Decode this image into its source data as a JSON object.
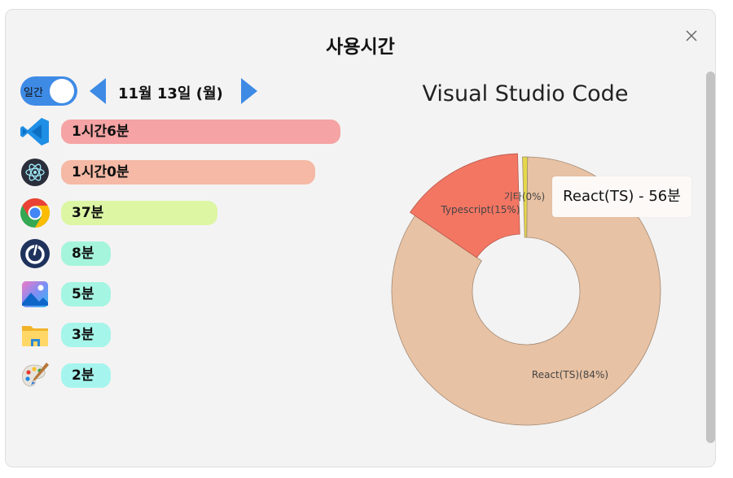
{
  "title": "사용시간",
  "toggle": {
    "label": "일간",
    "on": true,
    "color": "#3e8be6"
  },
  "date": "11월 13일 (월)",
  "apps": [
    {
      "icon": "vscode-icon",
      "duration": "1시간6분",
      "color": "#f5a3a4",
      "minutes": 66
    },
    {
      "icon": "electron-icon",
      "duration": "1시간0분",
      "color": "#f5b9a5",
      "minutes": 60
    },
    {
      "icon": "chrome-icon",
      "duration": "37분",
      "color": "#dcf6a4",
      "minutes": 37
    },
    {
      "icon": "mattermost-icon",
      "duration": "8분",
      "color": "#a5f5dc",
      "minutes": 8
    },
    {
      "icon": "photos-icon",
      "duration": "5분",
      "color": "#a5f5e3",
      "minutes": 5
    },
    {
      "icon": "file-explorer-icon",
      "duration": "3분",
      "color": "#a5f5ea",
      "minutes": 3
    },
    {
      "icon": "paint-icon",
      "duration": "2분",
      "color": "#a5f5ee",
      "minutes": 2
    }
  ],
  "tooltip": "React(TS) - 56분",
  "chart_data": {
    "type": "pie",
    "title": "Visual Studio Code",
    "slices": [
      {
        "label": "React(TS)(84%)",
        "name": "React(TS)",
        "value": 84,
        "color": "#e8c2a4"
      },
      {
        "label": "Typescript(15%)",
        "name": "Typescript",
        "value": 15,
        "color": "#f37663"
      },
      {
        "label": "기타(0%)",
        "name": "기타",
        "value": 0.6,
        "color": "#e4d84a"
      }
    ],
    "donut": true,
    "legend": "none"
  }
}
